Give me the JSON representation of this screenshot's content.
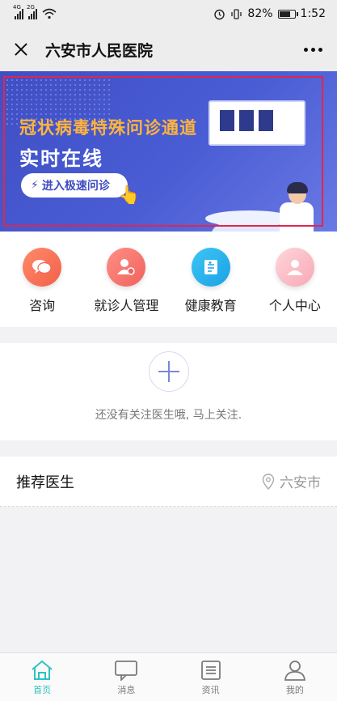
{
  "status_bar": {
    "signal1_tag": "4G",
    "signal2_tag": "2G",
    "battery": "82%",
    "battery_level": 0.82,
    "time": "1:52"
  },
  "nav": {
    "title": "六安市人民医院"
  },
  "banner": {
    "line1": "冠状病毒特殊问诊通道",
    "line2": "实时在线",
    "button": "进入极速问诊"
  },
  "quick_icons": [
    {
      "label": "咨询",
      "icon": "chat-bubble-icon"
    },
    {
      "label": "就诊人管理",
      "icon": "patient-management-icon"
    },
    {
      "label": "健康教育",
      "icon": "health-education-icon"
    },
    {
      "label": "个人中心",
      "icon": "personal-center-icon"
    }
  ],
  "follow": {
    "empty_text": "还没有关注医生哦, 马上关注."
  },
  "recommend": {
    "title": "推荐医生",
    "location": "六安市"
  },
  "tabbar": [
    {
      "label": "首页",
      "icon": "home-icon",
      "active": true
    },
    {
      "label": "消息",
      "icon": "message-icon",
      "active": false
    },
    {
      "label": "资讯",
      "icon": "news-icon",
      "active": false
    },
    {
      "label": "我的",
      "icon": "profile-icon",
      "active": false
    }
  ],
  "colors": {
    "accent": "#2ec2c2",
    "banner_bg": "#4a5dd4",
    "banner_highlight": "#ffb43c"
  }
}
